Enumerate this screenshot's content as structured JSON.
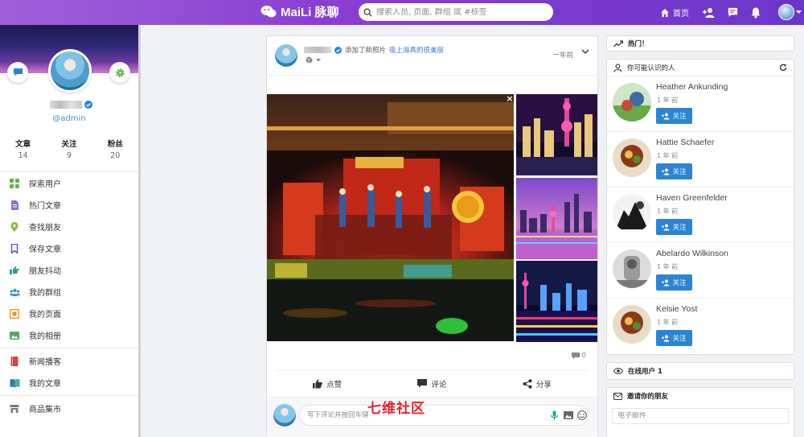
{
  "app": {
    "logo_text": "MaiLi 脉聊",
    "search_placeholder": "搜索人员, 页面, 群组 或 #标签",
    "home_label": "首页"
  },
  "profile": {
    "handle": "@admin",
    "stats": [
      {
        "label": "文章",
        "value": "14"
      },
      {
        "label": "关注",
        "value": "9"
      },
      {
        "label": "粉丝",
        "value": "20"
      }
    ]
  },
  "menu": {
    "items": [
      {
        "label": "探索用户",
        "icon": "explore-grid-icon",
        "color": "#6ab04c"
      },
      {
        "label": "热门文章",
        "icon": "document-icon",
        "color": "#8e6fd4"
      },
      {
        "label": "查找朋友",
        "icon": "map-pin-icon",
        "color": "#8cbf3f"
      },
      {
        "label": "保存文章",
        "icon": "bookmark-icon",
        "color": "#6c52c9"
      },
      {
        "label": "朋友抖动",
        "icon": "poke-hand-icon",
        "color": "#1ea5a0"
      },
      {
        "label": "我的群组",
        "icon": "users-icon",
        "color": "#3a8fd6"
      },
      {
        "label": "我的页面",
        "icon": "flag-icon",
        "color": "#f08a24"
      },
      {
        "label": "我的相册",
        "icon": "image-icon",
        "color": "#5aa85a"
      },
      {
        "label": "新闻播客",
        "icon": "news-book-icon",
        "color": "#d9443a"
      },
      {
        "label": "我的文章",
        "icon": "open-book-icon",
        "color": "#1a8a9c"
      },
      {
        "label": "商品集市",
        "icon": "store-icon",
        "color": "#7a7a7a"
      }
    ]
  },
  "post": {
    "action_text": "添加了新照片",
    "place_link": "夜上海真的很美丽",
    "time": "一年前",
    "comment_count": "0",
    "actions": {
      "like": "点赞",
      "comment": "评论",
      "share": "分享"
    },
    "composer_placeholder": "写下评论并按回车键"
  },
  "sidebar_right": {
    "trending_title": "热门！",
    "suggest_title": "你可能认识的人",
    "suggestions": [
      {
        "name": "Heather Ankunding",
        "time": "1 年 前",
        "follow": "关注"
      },
      {
        "name": "Hattie Schaefer",
        "time": "1 年 前",
        "follow": "关注"
      },
      {
        "name": "Haven Greenfelder",
        "time": "1 年 前",
        "follow": "关注"
      },
      {
        "name": "Abelardo Wilkinson",
        "time": "1 年 前",
        "follow": "关注"
      },
      {
        "name": "Kelsie Yost",
        "time": "1 年 前",
        "follow": "关注"
      }
    ],
    "online_title": "在线用户 1",
    "invite_title": "邀请你的朋友",
    "email_placeholder": "电子邮件"
  },
  "watermark": "七维社区",
  "colors": {
    "brand_purple": "#8a3fd3",
    "follow_blue": "#2a84d4",
    "link_blue": "#3b78c4"
  }
}
